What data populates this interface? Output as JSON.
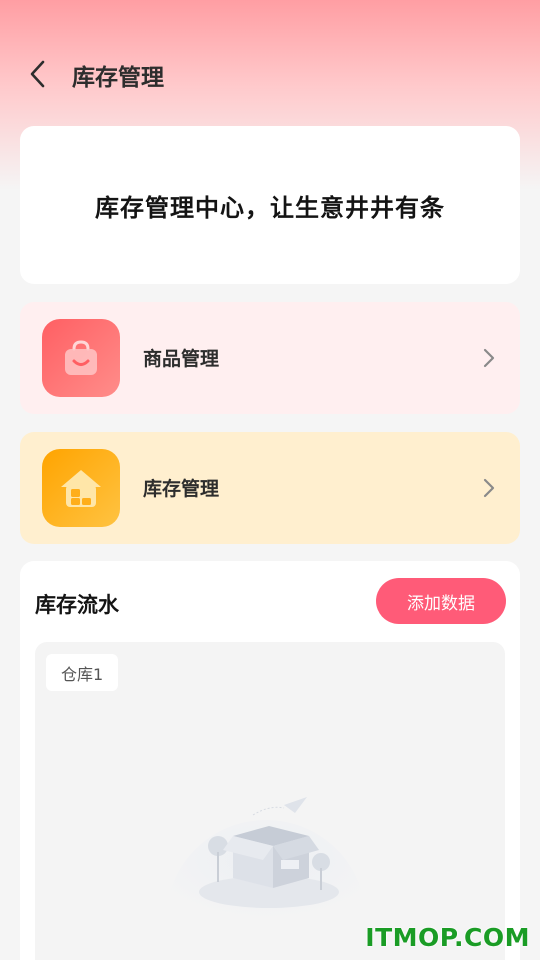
{
  "header": {
    "title": "库存管理"
  },
  "banner": {
    "text": "库存管理中心，让生意井井有条"
  },
  "menu": [
    {
      "label": "商品管理",
      "icon": "shopping-bag-icon",
      "color": "#ff6b6e"
    },
    {
      "label": "库存管理",
      "icon": "warehouse-house-icon",
      "color": "#ffa400"
    }
  ],
  "flow": {
    "title": "库存流水",
    "add_label": "添加数据",
    "warehouse_tab": "仓库1"
  },
  "watermark": "ITMOP.COM",
  "colors": {
    "accent": "#ff5b78",
    "header_gradient": "#ff9ea3"
  }
}
